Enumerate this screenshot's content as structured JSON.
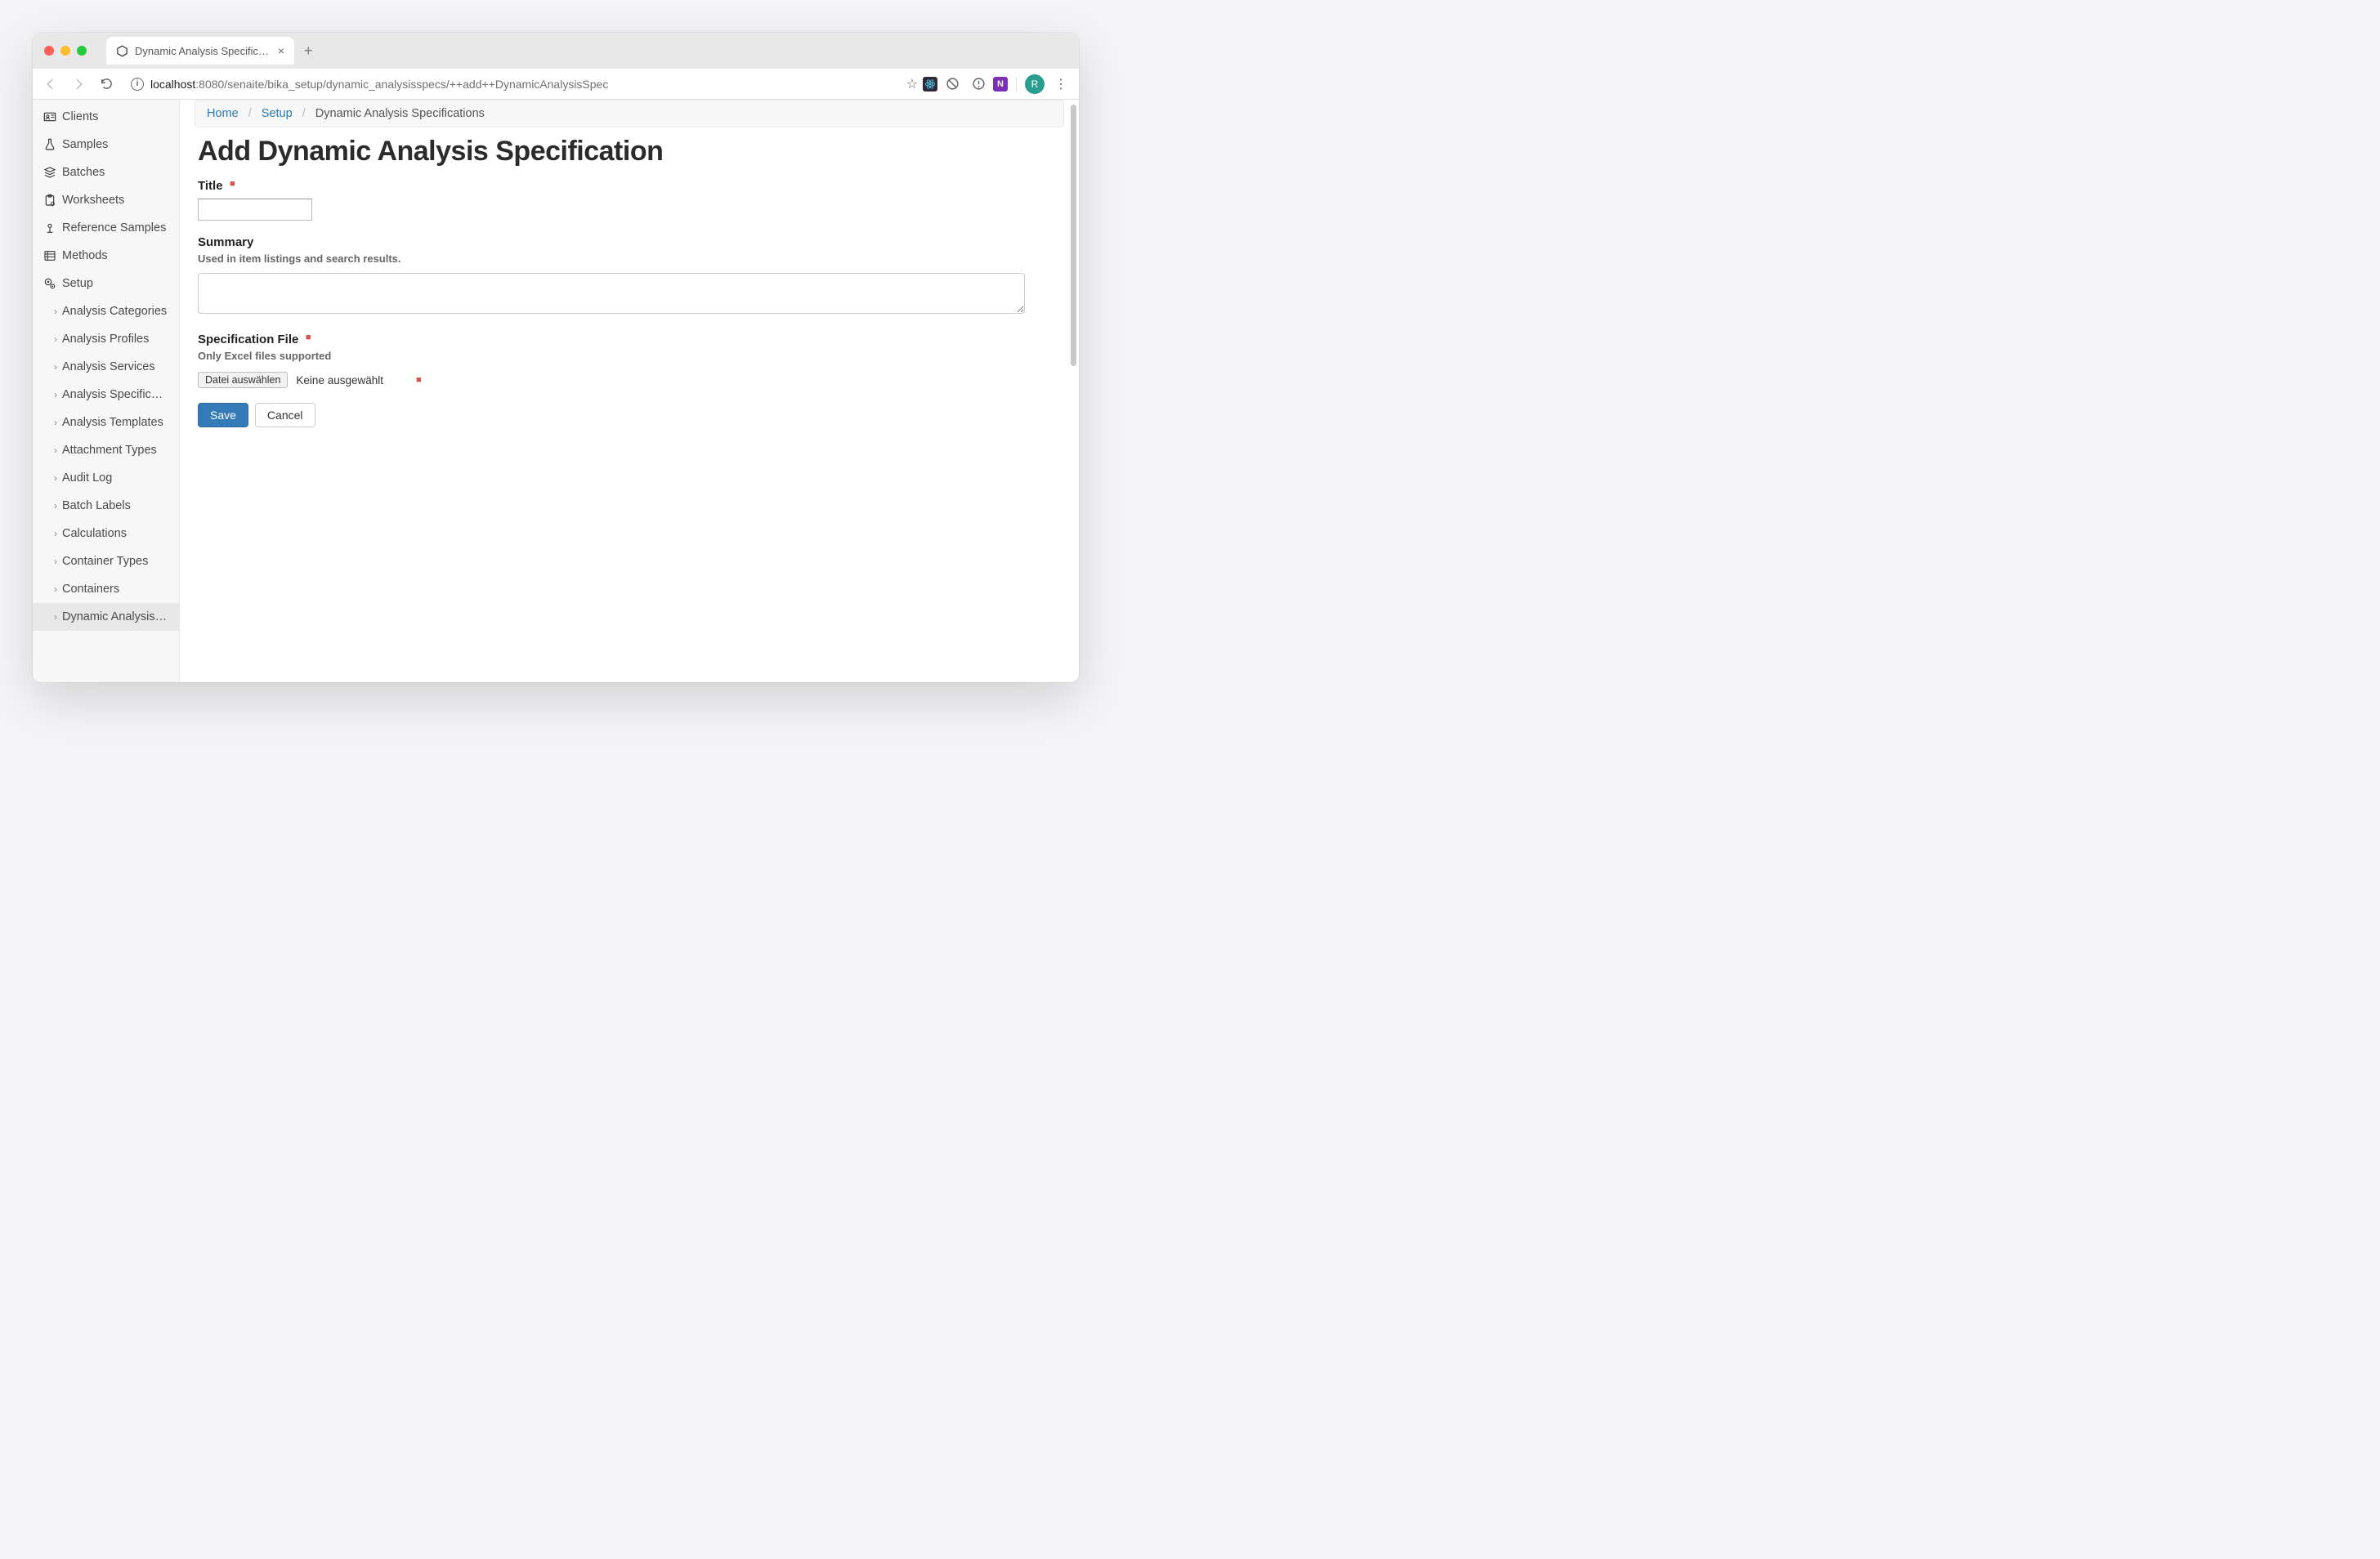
{
  "browser": {
    "tab_title": "Dynamic Analysis Specifications",
    "url_host": "localhost",
    "url_port_path": ":8080/senaite/bika_setup/dynamic_analysisspecs/++add++DynamicAnalysisSpec",
    "avatar_letter": "R"
  },
  "sidebar": {
    "items": [
      {
        "label": "Clients"
      },
      {
        "label": "Samples"
      },
      {
        "label": "Batches"
      },
      {
        "label": "Worksheets"
      },
      {
        "label": "Reference Samples"
      },
      {
        "label": "Methods"
      },
      {
        "label": "Setup"
      }
    ],
    "sub_items": [
      {
        "label": "Analysis Categories"
      },
      {
        "label": "Analysis Profiles"
      },
      {
        "label": "Analysis Services"
      },
      {
        "label": "Analysis Specific…"
      },
      {
        "label": "Analysis Templates"
      },
      {
        "label": "Attachment Types"
      },
      {
        "label": "Audit Log"
      },
      {
        "label": "Batch Labels"
      },
      {
        "label": "Calculations"
      },
      {
        "label": "Container Types"
      },
      {
        "label": "Containers"
      },
      {
        "label": "Dynamic Analysis…",
        "active": true
      }
    ]
  },
  "breadcrumbs": {
    "home": "Home",
    "setup": "Setup",
    "current": "Dynamic Analysis Specifications"
  },
  "page": {
    "title": "Add Dynamic Analysis Specification"
  },
  "form": {
    "title_label": "Title",
    "title_value": "",
    "summary_label": "Summary",
    "summary_help": "Used in item listings and search results.",
    "summary_value": "",
    "spec_label": "Specification File",
    "spec_help": "Only Excel files supported",
    "file_button": "Datei auswählen",
    "file_status": "Keine ausgewählt",
    "save": "Save",
    "cancel": "Cancel"
  }
}
